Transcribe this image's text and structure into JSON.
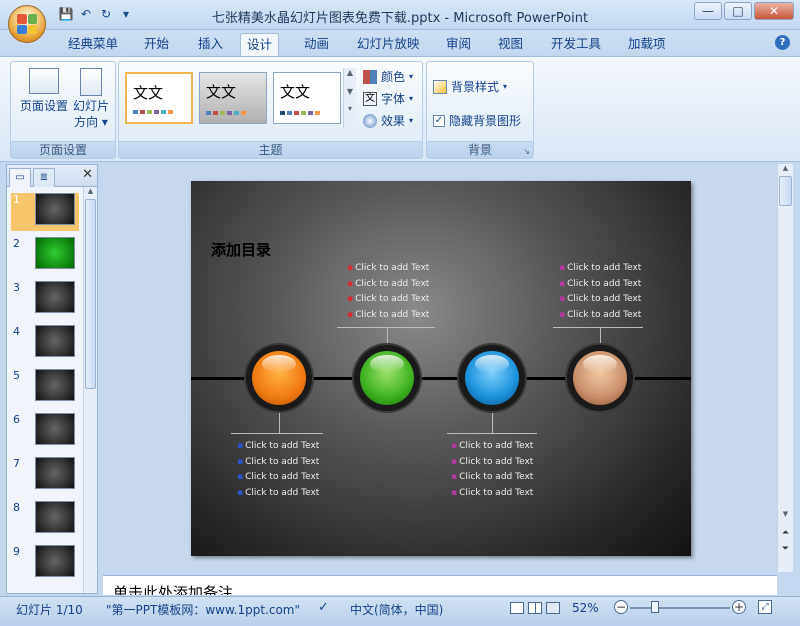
{
  "window": {
    "title": "七张精美水晶幻灯片图表免费下载.pptx - Microsoft PowerPoint",
    "min_label": "—",
    "max_label": "□",
    "close_label": "✕"
  },
  "qat": {
    "save": "💾",
    "undo": "↶",
    "redo": "↻",
    "more": "▾"
  },
  "tabs": [
    "经典菜单",
    "开始",
    "插入",
    "设计",
    "动画",
    "幻灯片放映",
    "审阅",
    "视图",
    "开发工具",
    "加载项"
  ],
  "active_tab": "设计",
  "ribbon": {
    "page_setup": {
      "label": "页面设置",
      "page_setup_btn": "页面设置",
      "orientation_btn_line1": "幻灯片",
      "orientation_btn_line2": "方向 ▾"
    },
    "themes": {
      "label": "主题",
      "thumb_text": "文文",
      "colors": "颜色",
      "fonts": "字体",
      "effects": "效果"
    },
    "background": {
      "label": "背景",
      "styles": "背景样式",
      "hide_graphics": "隐藏背景图形",
      "hide_checked": true
    }
  },
  "slides_panel": {
    "numbers": [
      "1",
      "2",
      "3",
      "4",
      "5",
      "6",
      "7",
      "8",
      "9"
    ],
    "active": 1
  },
  "slide": {
    "title": "添加目录",
    "placeholder": "Click to add Text",
    "top_left_items": [
      "Click to add Text",
      "Click to add Text",
      "Click to add Text",
      "Click to add Text"
    ],
    "top_right_items": [
      "Click to add Text",
      "Click to add Text",
      "Click to add Text",
      "Click to add Text"
    ],
    "bottom_left_items": [
      "Click to add Text",
      "Click to add Text",
      "Click to add Text",
      "Click to add Text"
    ],
    "bottom_right_items": [
      "Click to add Text",
      "Click to add Text",
      "Click to add Text",
      "Click to add Text"
    ],
    "orb_colors": [
      "#f07a10",
      "#3cb020",
      "#1a8fd8",
      "#c8906a"
    ]
  },
  "notes": {
    "placeholder": "单击此处添加备注"
  },
  "status": {
    "slide_info": "幻灯片 1/10",
    "theme": "\"第一PPT模板网：www.1ppt.com\"",
    "language": "中文(简体，中国)",
    "zoom": "52%"
  }
}
